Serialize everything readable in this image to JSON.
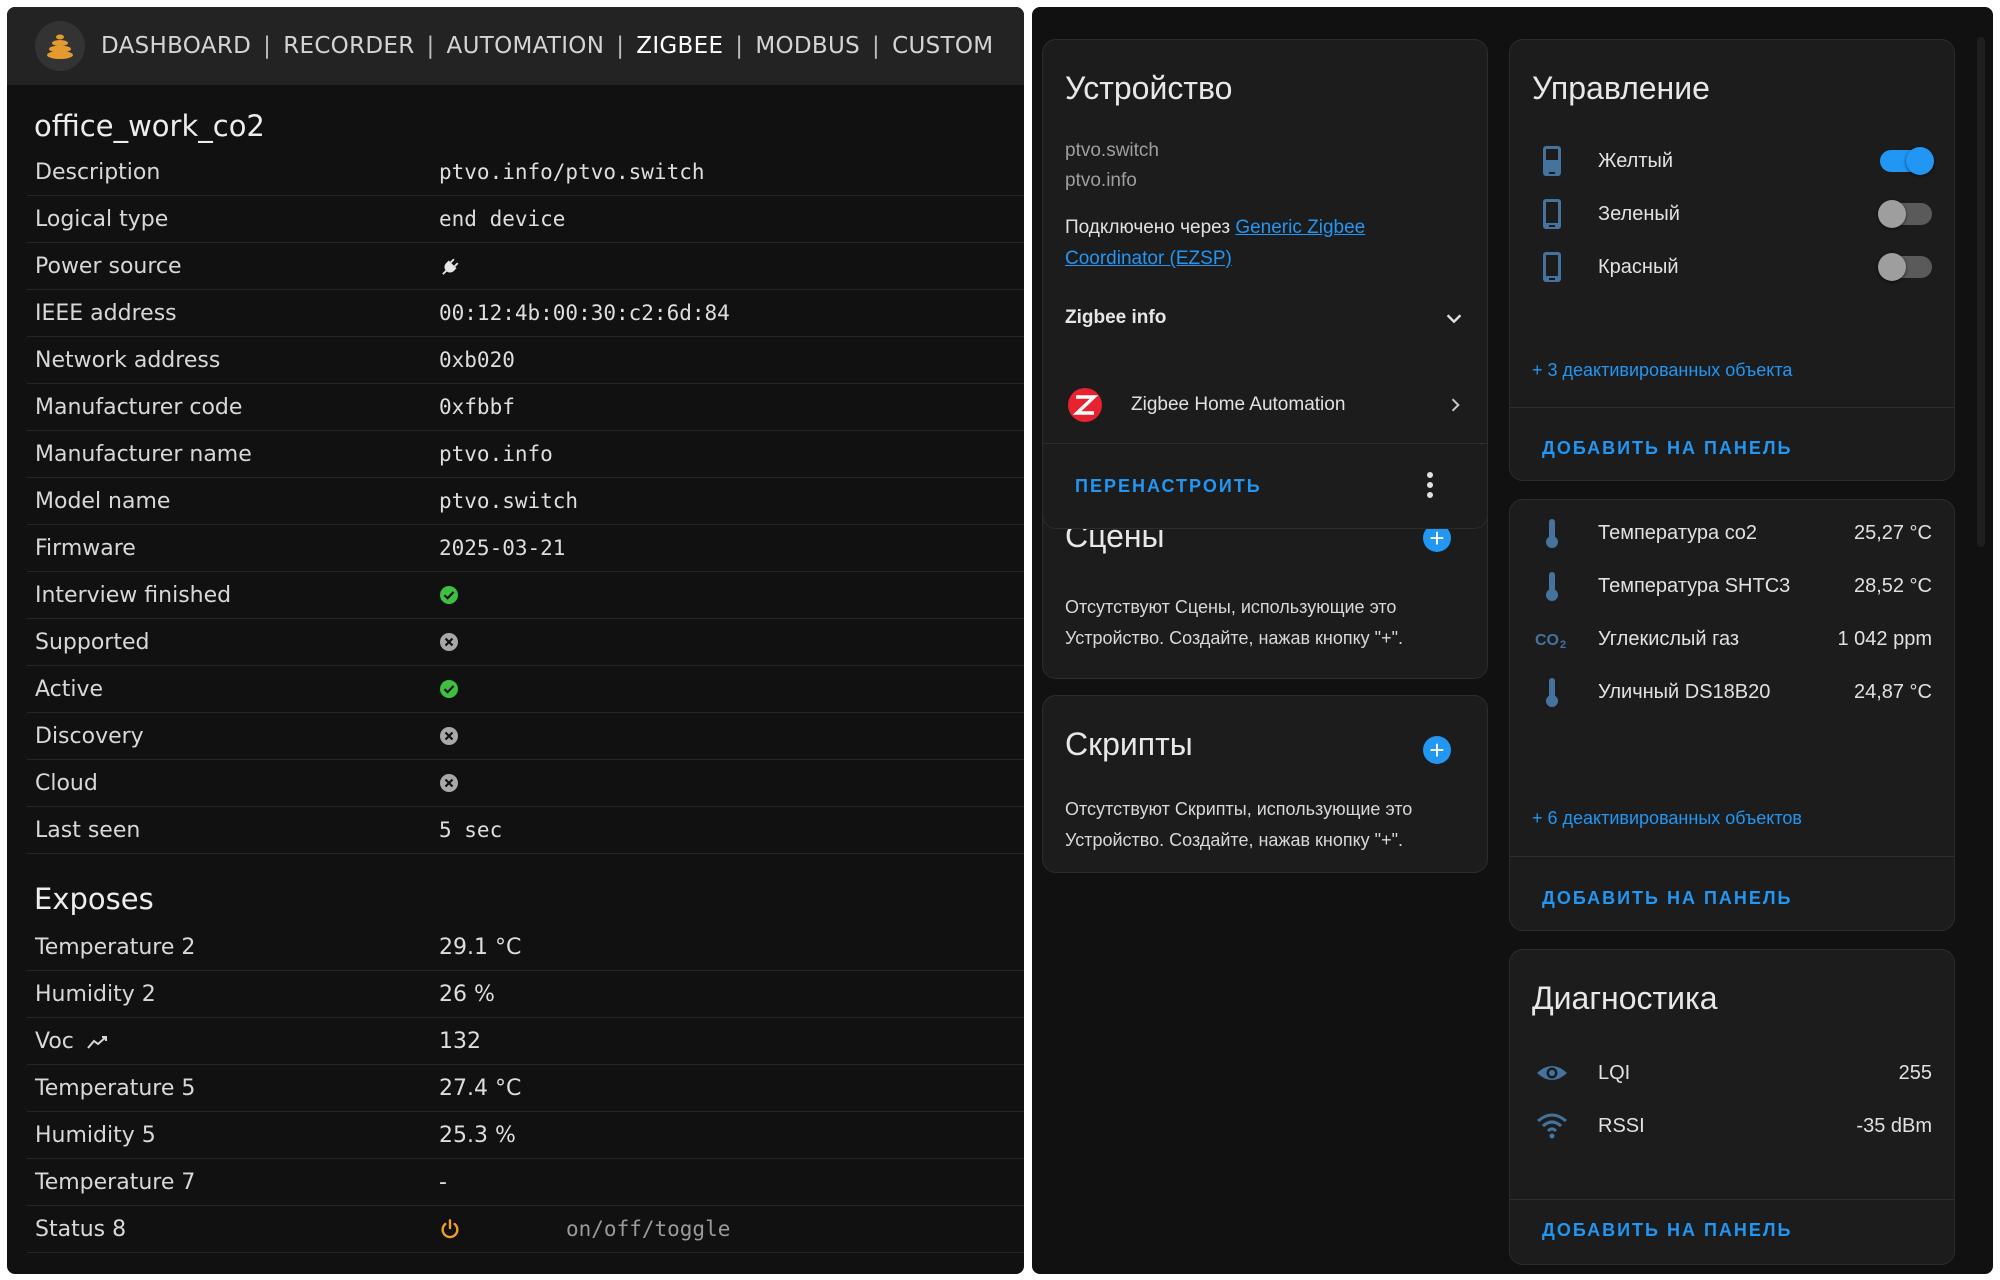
{
  "nav": {
    "items": [
      "DASHBOARD",
      "RECORDER",
      "AUTOMATION",
      "ZIGBEE",
      "MODBUS",
      "CUSTOM"
    ],
    "separator": "|",
    "active": "ZIGBEE"
  },
  "device": {
    "title": "office_work_co2",
    "rows": [
      {
        "label": "Description",
        "value": "ptvo.info/ptvo.switch",
        "kind": "mono"
      },
      {
        "label": "Logical type",
        "value": "end device",
        "kind": "mono"
      },
      {
        "label": "Power source",
        "value": "",
        "kind": "icon",
        "icon": "plug-icon"
      },
      {
        "label": "IEEE address",
        "value": "00:12:4b:00:30:c2:6d:84",
        "kind": "mono"
      },
      {
        "label": "Network address",
        "value": "0xb020",
        "kind": "mono"
      },
      {
        "label": "Manufacturer code",
        "value": "0xfbbf",
        "kind": "mono"
      },
      {
        "label": "Manufacturer name",
        "value": "ptvo.info",
        "kind": "mono"
      },
      {
        "label": "Model name",
        "value": "ptvo.switch",
        "kind": "mono"
      },
      {
        "label": "Firmware",
        "value": "2025-03-21",
        "kind": "mono"
      },
      {
        "label": "Interview finished",
        "value": "",
        "kind": "icon",
        "icon": "check-circle-icon"
      },
      {
        "label": "Supported",
        "value": "",
        "kind": "icon",
        "icon": "x-circle-icon"
      },
      {
        "label": "Active",
        "value": "",
        "kind": "icon",
        "icon": "check-circle-icon"
      },
      {
        "label": "Discovery",
        "value": "",
        "kind": "icon",
        "icon": "x-circle-icon"
      },
      {
        "label": "Cloud",
        "value": "",
        "kind": "icon",
        "icon": "x-circle-icon"
      },
      {
        "label": "Last seen",
        "value": "5 sec",
        "kind": "mono"
      }
    ]
  },
  "exposes": {
    "title": "Exposes",
    "rows": [
      {
        "label": "Temperature 2",
        "value": "29.1 °C"
      },
      {
        "label": "Humidity 2",
        "value": "26 %"
      },
      {
        "label": "Voc",
        "value": "132",
        "label_icon": "trend-icon"
      },
      {
        "label": "Temperature 5",
        "value": "27.4 °C"
      },
      {
        "label": "Humidity 5",
        "value": "25.3 %"
      },
      {
        "label": "Temperature 7",
        "value": "-"
      },
      {
        "label": "Status 8",
        "value": "",
        "icon": "power-icon",
        "hint": "on/off/toggle"
      }
    ]
  },
  "device_card": {
    "title": "Устройство",
    "model": "ptvo.switch",
    "manufacturer": "ptvo.info",
    "connected_via": "Подключено через",
    "coordinator_link": "Generic Zigbee Coordinator (EZSP)",
    "zigbee_info": "Zigbee info",
    "integration": "Zigbee Home Automation",
    "reconfigure": "ПЕРЕНАСТРОИТЬ"
  },
  "scenes_card": {
    "title": "Сцены",
    "text": "Отсутствуют Сцены, использующие это Устройство. Создайте, нажав кнопку \"+\"."
  },
  "scripts_card": {
    "title": "Скрипты",
    "text": "Отсутствуют Скрипты, использующие это Устройство. Создайте, нажав кнопку \"+\"."
  },
  "controls_card": {
    "title": "Управление",
    "items": [
      {
        "name": "Желтый",
        "on": true
      },
      {
        "name": "Зеленый",
        "on": false
      },
      {
        "name": "Красный",
        "on": false
      }
    ],
    "disabled_link": "+ 3 деактивированных объекта",
    "add_button": "ДОБАВИТЬ НА ПАНЕЛЬ"
  },
  "sensors_card": {
    "items": [
      {
        "name": "Температура co2",
        "value": "25,27 °C",
        "icon": "thermometer-icon"
      },
      {
        "name": "Температура SHTC3",
        "value": "28,52 °C",
        "icon": "thermometer-icon"
      },
      {
        "name": "Углекислый газ",
        "value": "1 042 ppm",
        "icon": "co2-icon"
      },
      {
        "name": "Уличный DS18B20",
        "value": "24,87 °C",
        "icon": "thermometer-icon"
      }
    ],
    "disabled_link": "+ 6 деактивированных объектов",
    "add_button": "ДОБАВИТЬ НА ПАНЕЛЬ"
  },
  "diagnostics_card": {
    "title": "Диагностика",
    "items": [
      {
        "name": "LQI",
        "value": "255",
        "icon": "eye-icon"
      },
      {
        "name": "RSSI",
        "value": "-35 dBm",
        "icon": "wifi-icon"
      }
    ],
    "add_button": "ДОБАВИТЬ НА ПАНЕЛЬ"
  },
  "colors": {
    "accent": "#2196f3",
    "ok": "#3fbf3f",
    "power": "#f0a020",
    "zha": "#e8222e"
  }
}
